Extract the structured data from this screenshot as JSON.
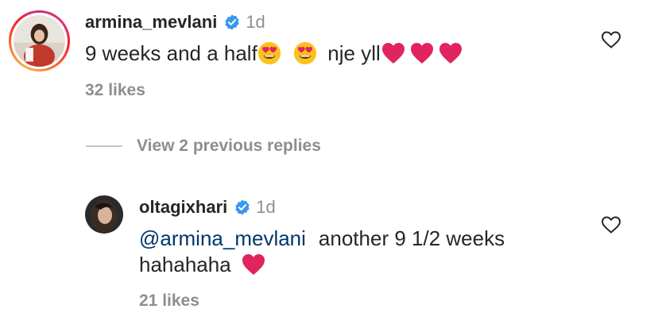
{
  "comments": [
    {
      "username": "armina_mevlani",
      "time": "1d",
      "text_parts": [
        "9 weeks and a half",
        " nje yll"
      ],
      "likes": "32 likes",
      "icons": [
        "verified-badge-icon",
        "heart-eyes-emoji-icon",
        "heart-eyes-emoji-icon",
        "red-heart-emoji-icon",
        "red-heart-emoji-icon",
        "red-heart-emoji-icon",
        "like-heart-icon"
      ]
    },
    {
      "username": "oltagixhari",
      "time": "1d",
      "mention": "@armina_mevlani",
      "text_line1": "another 9 1/2 weeks",
      "text_line2": "hahahaha",
      "likes": "21 likes",
      "icons": [
        "verified-badge-icon",
        "red-heart-emoji-icon",
        "like-heart-icon"
      ]
    }
  ],
  "replies": {
    "label": "View 2 previous replies"
  },
  "colors": {
    "text": "#262626",
    "muted": "#8e8e8e",
    "mention": "#00376b",
    "verified": "#3897f0",
    "heart": "#e0245e"
  }
}
